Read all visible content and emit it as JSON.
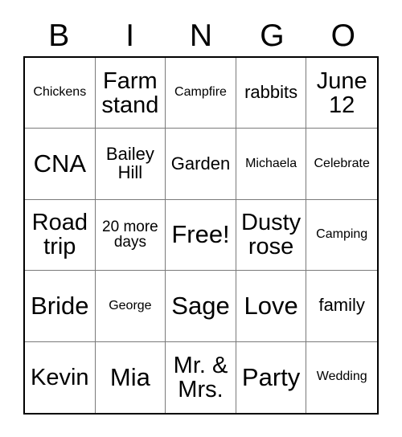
{
  "card": {
    "title": "BINGO Card",
    "background_color": "#ffffff",
    "text_color": "#000000",
    "grid_border_color": "#000000",
    "grid_line_color": "#7a7a7a"
  },
  "header": {
    "letters": [
      "B",
      "I",
      "N",
      "G",
      "O"
    ]
  },
  "grid": {
    "columns": 5,
    "rows": 5,
    "free_space": "Free!",
    "cells": [
      {
        "text": "Chickens",
        "size": "sz-xs"
      },
      {
        "text": "Farm stand",
        "size": "sz-lg"
      },
      {
        "text": "Campfire",
        "size": "sz-xs"
      },
      {
        "text": "rabbits",
        "size": "sz-md"
      },
      {
        "text": "June 12",
        "size": "sz-lg"
      },
      {
        "text": "CNA",
        "size": "sz-xl"
      },
      {
        "text": "Bailey Hill",
        "size": "sz-md"
      },
      {
        "text": "Garden",
        "size": "sz-md"
      },
      {
        "text": "Michaela",
        "size": "sz-xs"
      },
      {
        "text": "Celebrate",
        "size": "sz-xs"
      },
      {
        "text": "Road trip",
        "size": "sz-lg"
      },
      {
        "text": "20 more days",
        "size": "sz-sm"
      },
      {
        "text": "Free!",
        "size": "sz-xl"
      },
      {
        "text": "Dusty rose",
        "size": "sz-lg"
      },
      {
        "text": "Camping",
        "size": "sz-xs"
      },
      {
        "text": "Bride",
        "size": "sz-xl"
      },
      {
        "text": "George",
        "size": "sz-xs"
      },
      {
        "text": "Sage",
        "size": "sz-xl"
      },
      {
        "text": "Love",
        "size": "sz-xl"
      },
      {
        "text": "family",
        "size": "sz-md"
      },
      {
        "text": "Kevin",
        "size": "sz-lg"
      },
      {
        "text": "Mia",
        "size": "sz-xl"
      },
      {
        "text": "Mr. & Mrs.",
        "size": "sz-lg"
      },
      {
        "text": "Party",
        "size": "sz-xl"
      },
      {
        "text": "Wedding",
        "size": "sz-xs"
      }
    ]
  }
}
